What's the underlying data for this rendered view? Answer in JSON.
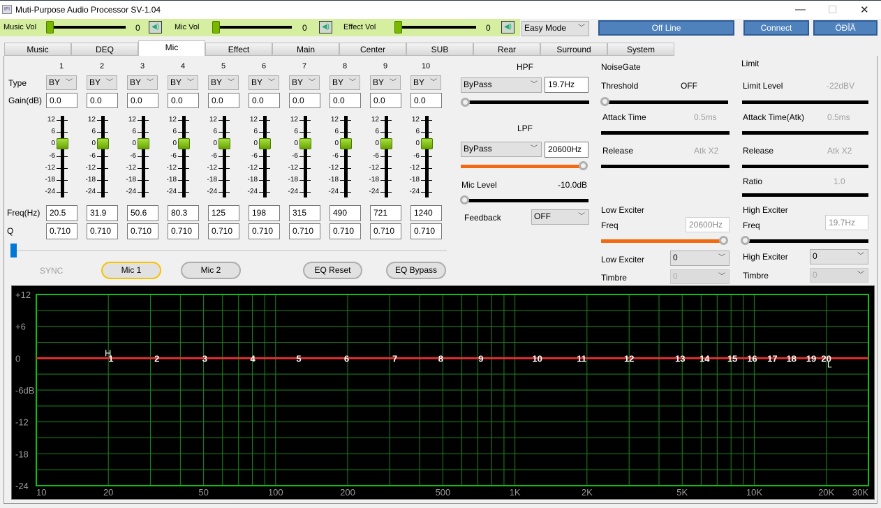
{
  "window": {
    "title": "Muti-Purpose Audio Processor SV-1.04",
    "icon_text": "IFI",
    "minimize": "—",
    "maximize": "☐",
    "close": "✕"
  },
  "topbar": {
    "music_vol": {
      "label": "Music Vol",
      "value": "0",
      "level": 0
    },
    "mic_vol": {
      "label": "Mic Vol",
      "value": "0",
      "level": 0
    },
    "effect_vol": {
      "label": "Effect Vol",
      "value": "0",
      "level": 0
    },
    "mode": "Easy Mode",
    "status_button": "Off Line",
    "connect_button": "Connect",
    "lang_button": "ÖÐÎÃ",
    "accent": "#4f81bd",
    "bar_color": "#d5eea0"
  },
  "tabs": [
    {
      "label": "Music"
    },
    {
      "label": "DEQ"
    },
    {
      "label": "Mic",
      "active": true
    },
    {
      "label": "Effect"
    },
    {
      "label": "Main"
    },
    {
      "label": "Center"
    },
    {
      "label": "SUB"
    },
    {
      "label": "Rear"
    },
    {
      "label": "Surround"
    },
    {
      "label": "System"
    }
  ],
  "eq": {
    "type_label": "Type",
    "gain_label": "Gain(dB)",
    "freq_label": "Freq(Hz)",
    "q_label": "Q",
    "scale": [
      "12",
      "6",
      "0",
      "-6",
      "-12",
      "-18",
      "-24"
    ],
    "bands": [
      {
        "num": "1",
        "type": "BY",
        "gain": "0.0",
        "freq": "20.5",
        "q": "0.710"
      },
      {
        "num": "2",
        "type": "BY",
        "gain": "0.0",
        "freq": "31.9",
        "q": "0.710"
      },
      {
        "num": "3",
        "type": "BY",
        "gain": "0.0",
        "freq": "50.6",
        "q": "0.710"
      },
      {
        "num": "4",
        "type": "BY",
        "gain": "0.0",
        "freq": "80.3",
        "q": "0.710"
      },
      {
        "num": "5",
        "type": "BY",
        "gain": "0.0",
        "freq": "125",
        "q": "0.710"
      },
      {
        "num": "6",
        "type": "BY",
        "gain": "0.0",
        "freq": "198",
        "q": "0.710"
      },
      {
        "num": "7",
        "type": "BY",
        "gain": "0.0",
        "freq": "315",
        "q": "0.710"
      },
      {
        "num": "8",
        "type": "BY",
        "gain": "0.0",
        "freq": "490",
        "q": "0.710"
      },
      {
        "num": "9",
        "type": "BY",
        "gain": "0.0",
        "freq": "721",
        "q": "0.710"
      },
      {
        "num": "10",
        "type": "BY",
        "gain": "0.0",
        "freq": "1240",
        "q": "0.710"
      }
    ],
    "sync": "SYNC",
    "mic1": "Mic 1",
    "mic2": "Mic 2",
    "reset": "EQ Reset",
    "bypass": "EQ Bypass"
  },
  "filters": {
    "hpf": {
      "label": "HPF",
      "type": "ByPass",
      "freq": "19.7Hz",
      "level": 0
    },
    "lpf": {
      "label": "LPF",
      "type": "ByPass",
      "freq": "20600Hz",
      "level": 1
    },
    "mic_level": {
      "label": "Mic Level",
      "value": "-10.0dB",
      "level": 0
    },
    "feedback": {
      "label": "Feedback",
      "value": "OFF"
    }
  },
  "noisegate": {
    "title": "NoiseGate",
    "threshold": {
      "label": "Threshold",
      "value": "OFF"
    },
    "attack": {
      "label": "Attack Time",
      "value": "0.5ms"
    },
    "release": {
      "label": "Release",
      "value": "Atk X2"
    }
  },
  "low_exciter": {
    "title": "Low Exciter",
    "freq_label": "Freq",
    "freq": "20600Hz",
    "level": 1,
    "select_label": "Low Exciter",
    "select": "0",
    "timbre_label": "Timbre",
    "timbre": "0"
  },
  "limit": {
    "title": "Limit",
    "level": {
      "label": "Limit Level",
      "value": "-22dBV"
    },
    "attack": {
      "label": "Attack Time(Atk)",
      "value": "0.5ms"
    },
    "release": {
      "label": "Release",
      "value": "Atk X2"
    },
    "ratio": {
      "label": "Ratio",
      "value": "1.0"
    }
  },
  "high_exciter": {
    "title": "High Exciter",
    "freq_label": "Freq",
    "freq": "19.7Hz",
    "level": 0,
    "select_label": "High Exciter",
    "select": "0",
    "timbre_label": "Timbre",
    "timbre": "0"
  },
  "chart_data": {
    "type": "line",
    "x_scale": "log",
    "xlim": [
      10,
      30000
    ],
    "ylim": [
      -24,
      12
    ],
    "grid": true,
    "x_ticks": [
      {
        "v": 10,
        "label": "10"
      },
      {
        "v": 20,
        "label": "20"
      },
      {
        "v": 50,
        "label": "50"
      },
      {
        "v": 100,
        "label": "100"
      },
      {
        "v": 200,
        "label": "200"
      },
      {
        "v": 500,
        "label": "500"
      },
      {
        "v": 1000,
        "label": "1K"
      },
      {
        "v": 2000,
        "label": "2K"
      },
      {
        "v": 5000,
        "label": "5K"
      },
      {
        "v": 10000,
        "label": "10K"
      },
      {
        "v": 20000,
        "label": "20K"
      },
      {
        "v": 30000,
        "label": "30K"
      }
    ],
    "y_ticks": [
      {
        "v": 12,
        "label": "+12"
      },
      {
        "v": 6,
        "label": "+6"
      },
      {
        "v": 0,
        "label": "0"
      },
      {
        "v": -6,
        "label": "-6dB"
      },
      {
        "v": -12,
        "label": "-12"
      },
      {
        "v": -18,
        "label": "-18"
      },
      {
        "v": -24,
        "label": "-24"
      }
    ],
    "response": {
      "x": [
        10,
        30000
      ],
      "y": [
        0,
        0
      ],
      "color": "#e03030"
    },
    "band_markers": [
      {
        "label": "1",
        "freq": 20.5
      },
      {
        "label": "2",
        "freq": 31.9
      },
      {
        "label": "3",
        "freq": 50.6
      },
      {
        "label": "4",
        "freq": 80.3
      },
      {
        "label": "5",
        "freq": 125
      },
      {
        "label": "6",
        "freq": 198
      },
      {
        "label": "7",
        "freq": 315
      },
      {
        "label": "8",
        "freq": 490
      },
      {
        "label": "9",
        "freq": 721
      },
      {
        "label": "10",
        "freq": 1240
      },
      {
        "label": "11",
        "freq": 1900
      },
      {
        "label": "12",
        "freq": 3000
      },
      {
        "label": "13",
        "freq": 4900
      },
      {
        "label": "14",
        "freq": 6200
      },
      {
        "label": "15",
        "freq": 8100
      },
      {
        "label": "16",
        "freq": 9800
      },
      {
        "label": "17",
        "freq": 11900
      },
      {
        "label": "18",
        "freq": 14300
      },
      {
        "label": "19",
        "freq": 17300
      },
      {
        "label": "20",
        "freq": 20000
      }
    ],
    "hpf_marker": {
      "label": "H",
      "freq": 19.7
    },
    "lpf_marker": {
      "label": "L",
      "freq": 20600
    },
    "grid_color": "#1a8a1a",
    "border_color": "#10c010"
  }
}
